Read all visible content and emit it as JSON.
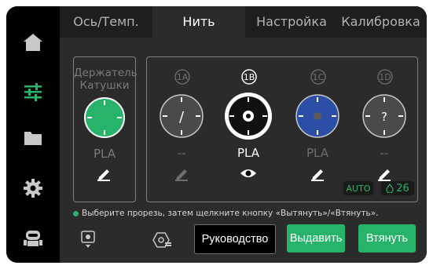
{
  "tabs": [
    {
      "label": "Ось/Темп."
    },
    {
      "label": "Нить"
    },
    {
      "label": "Настройка"
    },
    {
      "label": "Калибровка"
    }
  ],
  "active_tab": "Нить",
  "sidebar": [
    {
      "icon": "home-icon"
    },
    {
      "icon": "sliders-icon",
      "active": true
    },
    {
      "icon": "folder-icon"
    },
    {
      "icon": "gear-icon"
    },
    {
      "icon": "robot-icon"
    }
  ],
  "spool_holder": {
    "label_line1": "Держатель",
    "label_line2": "Катушки",
    "material": "PLA",
    "color": "#27b46a"
  },
  "ams_slots": [
    {
      "id": "1A",
      "material": "--",
      "symbol": "/",
      "color": "#4a4a4a",
      "material_active": false
    },
    {
      "id": "1B",
      "material": "PLA",
      "symbol": "",
      "color": "#111111",
      "material_active": true
    },
    {
      "id": "1C",
      "material": "PLA",
      "symbol": "",
      "color": "#2b4fa6",
      "material_active": false
    },
    {
      "id": "1D",
      "material": "--",
      "symbol": "?",
      "color": "#4a4a4a",
      "material_active": false
    }
  ],
  "auto_badge": "AUTO",
  "humidity_value": "26",
  "hint_text": "Выберите прорезь, затем щелкните кнопку «Вытянуть»/«Втянуть».",
  "buttons": {
    "guide": "Руководство",
    "extrude": "Выдавить",
    "retract": "Втянуть"
  },
  "colors": {
    "accent_green": "#27b46a",
    "auto_badge_text": "#27b46a",
    "humidity_text": "#27b46a"
  }
}
